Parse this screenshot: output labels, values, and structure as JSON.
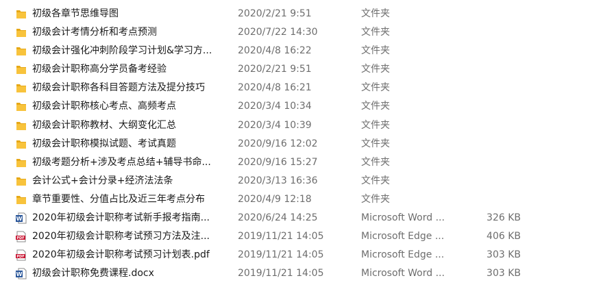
{
  "files": [
    {
      "name": "初级各章节思维导图",
      "date": "2020/2/21 9:51",
      "type": "文件夹",
      "size": "",
      "icon": "folder-icon"
    },
    {
      "name": "初级会计考情分析和考点预测",
      "date": "2020/7/22 14:30",
      "type": "文件夹",
      "size": "",
      "icon": "folder-icon"
    },
    {
      "name": "初级会计强化冲刺阶段学习计划&学习方...",
      "date": "2020/4/8 16:22",
      "type": "文件夹",
      "size": "",
      "icon": "folder-icon"
    },
    {
      "name": "初级会计职称高分学员备考经验",
      "date": "2020/2/21 9:51",
      "type": "文件夹",
      "size": "",
      "icon": "folder-icon"
    },
    {
      "name": "初级会计职称各科目答题方法及提分技巧",
      "date": "2020/4/8 16:21",
      "type": "文件夹",
      "size": "",
      "icon": "folder-icon"
    },
    {
      "name": "初级会计职称核心考点、高频考点",
      "date": "2020/3/4 10:34",
      "type": "文件夹",
      "size": "",
      "icon": "folder-icon"
    },
    {
      "name": "初级会计职称教材、大纲变化汇总",
      "date": "2020/3/4 10:39",
      "type": "文件夹",
      "size": "",
      "icon": "folder-icon"
    },
    {
      "name": "初级会计职称模拟试题、考试真题",
      "date": "2020/9/16 12:02",
      "type": "文件夹",
      "size": "",
      "icon": "folder-icon"
    },
    {
      "name": "初级考题分析+涉及考点总结+辅导书命...",
      "date": "2020/9/16 15:27",
      "type": "文件夹",
      "size": "",
      "icon": "folder-icon"
    },
    {
      "name": "会计公式+会计分录+经济法法条",
      "date": "2020/3/13 16:36",
      "type": "文件夹",
      "size": "",
      "icon": "folder-icon"
    },
    {
      "name": "章节重要性、分值占比及近三年考点分布",
      "date": "2020/4/9 12:18",
      "type": "文件夹",
      "size": "",
      "icon": "folder-icon"
    },
    {
      "name": "2020年初级会计职称考试新手报考指南...",
      "date": "2020/6/24 14:25",
      "type": "Microsoft Word ...",
      "size": "326 KB",
      "icon": "word-doc-icon"
    },
    {
      "name": "2020年初级会计职称考试预习方法及注...",
      "date": "2019/11/21 14:05",
      "type": "Microsoft Edge ...",
      "size": "406 KB",
      "icon": "pdf-icon"
    },
    {
      "name": "2020年初级会计职称考试预习计划表.pdf",
      "date": "2019/11/21 14:05",
      "type": "Microsoft Edge ...",
      "size": "303 KB",
      "icon": "pdf-icon"
    },
    {
      "name": "初级会计职称免费课程.docx",
      "date": "2019/11/21 14:05",
      "type": "Microsoft Word ...",
      "size": "303 KB",
      "icon": "word-doc-icon"
    }
  ],
  "colors": {
    "folder": "#f8c33c",
    "folder_shade": "#e6a817",
    "word": "#2b579a",
    "pdf": "#c8102e",
    "secondary_text": "#6d6d6d"
  }
}
